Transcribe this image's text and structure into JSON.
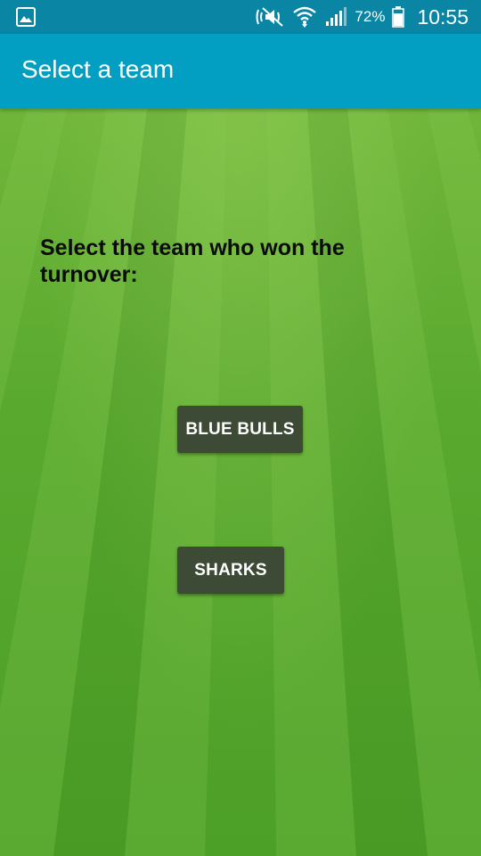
{
  "status_bar": {
    "battery_percent": "72%",
    "time": "10:55",
    "icons": [
      "image-icon",
      "mute-icon",
      "wifi-icon",
      "signal-icon",
      "battery-icon"
    ]
  },
  "app_bar": {
    "title": "Select a team"
  },
  "main": {
    "prompt": "Select the team who won the turnover:",
    "buttons": [
      {
        "label": "BLUE BULLS"
      },
      {
        "label": "SHARKS"
      }
    ]
  },
  "colors": {
    "status_bar": "#0a85a3",
    "app_bar": "#039fc3",
    "button": "#3c4a36",
    "grass_light": "#6fb63a",
    "grass_dark": "#4c9f27"
  }
}
